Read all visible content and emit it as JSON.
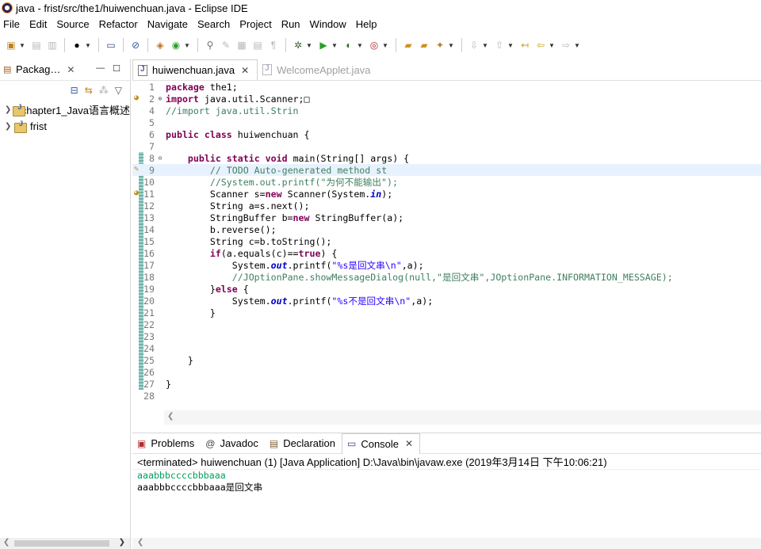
{
  "window": {
    "title": "java - frist/src/the1/huiwenchuan.java - Eclipse IDE"
  },
  "menu": [
    "File",
    "Edit",
    "Source",
    "Refactor",
    "Navigate",
    "Search",
    "Project",
    "Run",
    "Window",
    "Help"
  ],
  "left_pane": {
    "tab_label": "Packag…",
    "tree": [
      {
        "label": "chapter1_Java语言概述"
      },
      {
        "label": "frist"
      }
    ]
  },
  "editor": {
    "tabs": [
      {
        "label": "huiwenchuan.java",
        "active": true
      },
      {
        "label": "WelcomeApplet.java",
        "active": false
      }
    ],
    "current_line": 9,
    "lines": [
      {
        "n": "1",
        "code": "package the1;"
      },
      {
        "n": "2",
        "code": "import java.util.Scanner;□",
        "fold": "plus"
      },
      {
        "n": "4",
        "code": "//import java.util.Strin"
      },
      {
        "n": "5",
        "code": ""
      },
      {
        "n": "6",
        "code": "public class huiwenchuan {"
      },
      {
        "n": "7",
        "code": ""
      },
      {
        "n": "8",
        "code": "    public static void main(String[] args) {",
        "fold": "minus"
      },
      {
        "n": "9",
        "code": "        // TODO Auto-generated method st"
      },
      {
        "n": "10",
        "code": "        //System.out.printf(\"为何不能输出\");"
      },
      {
        "n": "11",
        "code": "        Scanner s=new Scanner(System.in);"
      },
      {
        "n": "12",
        "code": "        String a=s.next();"
      },
      {
        "n": "13",
        "code": "        StringBuffer b=new StringBuffer(a);"
      },
      {
        "n": "14",
        "code": "        b.reverse();"
      },
      {
        "n": "15",
        "code": "        String c=b.toString();"
      },
      {
        "n": "16",
        "code": "        if(a.equals(c)==true) {"
      },
      {
        "n": "17",
        "code": "            System.out.printf(\"%s是回文串\\n\",a);"
      },
      {
        "n": "18",
        "code": "            //JOptionPane.showMessageDialog(null,\"是回文串\",JOptionPane.INFORMATION_MESSAGE);"
      },
      {
        "n": "19",
        "code": "        }else {"
      },
      {
        "n": "20",
        "code": "            System.out.printf(\"%s不是回文串\\n\",a);"
      },
      {
        "n": "21",
        "code": "        }"
      },
      {
        "n": "22",
        "code": ""
      },
      {
        "n": "23",
        "code": ""
      },
      {
        "n": "24",
        "code": ""
      },
      {
        "n": "25",
        "code": "    }"
      },
      {
        "n": "26",
        "code": ""
      },
      {
        "n": "27",
        "code": "}"
      },
      {
        "n": "28",
        "code": ""
      }
    ]
  },
  "bottom_pane": {
    "tabs": [
      {
        "label": "Problems",
        "icon": "problems-icon"
      },
      {
        "label": "Javadoc",
        "icon": "javadoc-icon"
      },
      {
        "label": "Declaration",
        "icon": "declaration-icon"
      },
      {
        "label": "Console",
        "icon": "console-icon",
        "active": true
      }
    ],
    "console_header": "<terminated> huiwenchuan (1) [Java Application] D:\\Java\\bin\\javaw.exe (2019年3月14日 下午10:06:21)",
    "input_line": "aaabbbccccbbbaaa",
    "output_line": "aaabbbccccbbbaaa是回文串"
  },
  "colors": {
    "keyword": "#7f0055",
    "comment": "#3f7f5f",
    "string": "#2a00ff",
    "console_input": "#00a060"
  }
}
